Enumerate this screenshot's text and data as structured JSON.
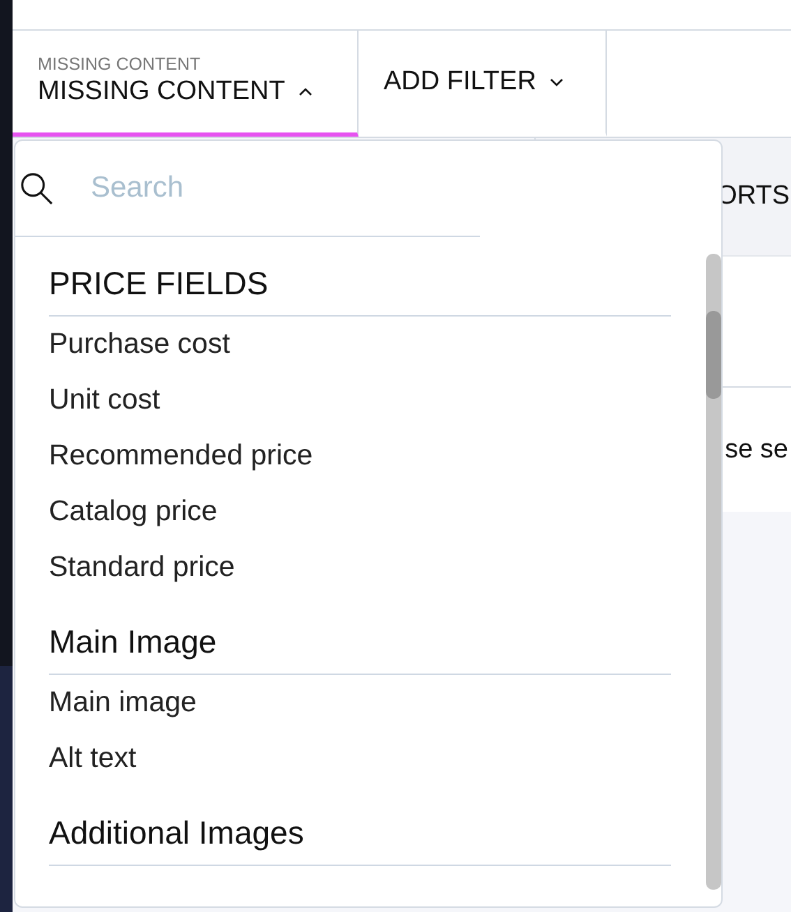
{
  "filter_bar": {
    "filters": [
      {
        "caption": "MISSING CONTENT",
        "label": "MISSING CONTENT",
        "expanded": true,
        "selected": true
      },
      {
        "label": "ADD FILTER",
        "expanded": false,
        "selected": false
      }
    ]
  },
  "dropdown": {
    "search": {
      "placeholder": "Search"
    },
    "groups": [
      {
        "title": "PRICE FIELDS",
        "items": [
          "Purchase cost",
          "Unit cost",
          "Recommended price",
          "Catalog price",
          "Standard price"
        ]
      },
      {
        "title": "Main Image",
        "items": [
          "Main image",
          "Alt text"
        ]
      },
      {
        "title": "Additional Images"
      }
    ]
  },
  "background": {
    "heading": "ORTS",
    "text": "se se"
  }
}
